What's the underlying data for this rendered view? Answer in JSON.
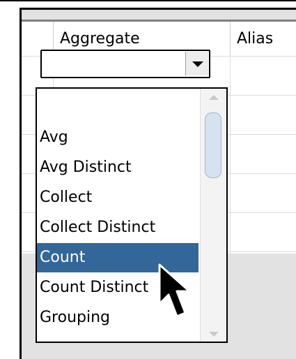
{
  "header": {
    "columns": [
      {
        "label": ""
      },
      {
        "label": "Aggregate"
      },
      {
        "label": "Alias"
      }
    ]
  },
  "aggregate_combo": {
    "value": ""
  },
  "dropdown": {
    "options": [
      {
        "label": ""
      },
      {
        "label": "Avg"
      },
      {
        "label": "Avg Distinct"
      },
      {
        "label": "Collect"
      },
      {
        "label": "Collect Distinct"
      },
      {
        "label": "Count"
      },
      {
        "label": "Count Distinct"
      },
      {
        "label": "Grouping"
      }
    ],
    "selected": "Count"
  },
  "icons": {
    "combo_arrow": "chevron-down-icon",
    "scroll_up": "scroll-up-arrow-icon",
    "scroll_down": "scroll-down-arrow-icon",
    "cursor": "mouse-pointer-icon"
  },
  "colors": {
    "selection_bg": "#336699",
    "scroll_thumb": "#d6e2f0",
    "panel_bg": "#e2e2e2"
  }
}
